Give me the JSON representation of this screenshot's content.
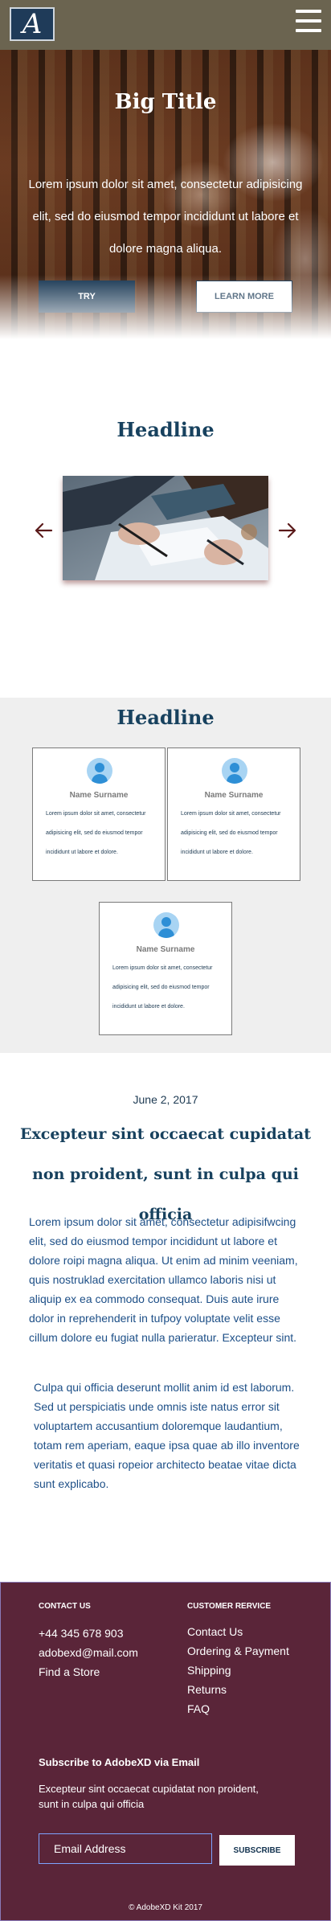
{
  "header": {
    "logo_letter": "A",
    "menu_icon": "hamburger-menu-icon"
  },
  "hero": {
    "title": "Big Title",
    "text": "Lorem ipsum dolor sit amet, consectetur adipisicing elit, sed do eiusmod tempor incididunt ut labore et dolore magna aliqua.",
    "try_label": "TRY",
    "learn_label": "LEARN MORE"
  },
  "carousel": {
    "headline": "Headline",
    "prev_icon": "arrow-left-icon",
    "next_icon": "arrow-right-icon",
    "arrow_color": "#5a1a1a"
  },
  "team": {
    "headline": "Headline",
    "members": [
      {
        "name": "Name Surname",
        "bio": "Lorem ipsum dolor sit amet, consectetur adipisicing elit, sed do eiusmod tempor incididunt ut labore et dolore."
      },
      {
        "name": "Name Surname",
        "bio": "Lorem ipsum dolor sit amet, consectetur adipisicing elit, sed do eiusmod tempor incididunt ut labore et dolore."
      },
      {
        "name": "Name Surname",
        "bio": "Lorem ipsum dolor sit amet, consectetur adipisicing elit, sed do eiusmod tempor incididunt ut labore et dolore."
      }
    ]
  },
  "article": {
    "date": "June 2, 2017",
    "title": "Excepteur sint occaecat cupidatat non proident, sunt in culpa qui officia",
    "paragraph1": "Lorem ipsum dolor sit amet, consectetur adipisifwcing elit, sed do eiusmod tempor incididunt ut labore et dolore roipi magna aliqua. Ut enim ad minim veeniam, quis nostruklad exercitation ullamco laboris nisi ut aliquip ex ea commodo consequat. Duis aute irure dolor in reprehenderit in tufpoy voluptate velit esse cillum dolore eu fugiat nulla parieratur. Excepteur sint.",
    "paragraph2": "Culpa qui officia deserunt mollit anim id est laborum. Sed ut perspiciatis unde omnis iste natus error sit voluptartem accusantium doloremque laudantium, totam rem aperiam, eaque ipsa quae ab illo inventore veritatis et quasi ropeior architecto beatae vitae dicta sunt explicabo."
  },
  "footer": {
    "contact_heading": "CONTACT US",
    "phone": "+44 345 678 903",
    "email": "adobexd@mail.com",
    "find_store": "Find a Store",
    "service_heading": "CUSTOMER RERVICE",
    "service_links": [
      "Contact Us",
      "Ordering & Payment",
      "Shipping",
      "Returns",
      "FAQ"
    ],
    "subscribe_title": "Subscribe to AdobeXD via Email",
    "subscribe_text": "Excepteur sint occaecat cupidatat non proident, sunt in culpa qui officia",
    "email_placeholder": "Email Address",
    "subscribe_label": "SUBSCRIBE",
    "copyright": "© AdobeXD Kit 2017"
  }
}
